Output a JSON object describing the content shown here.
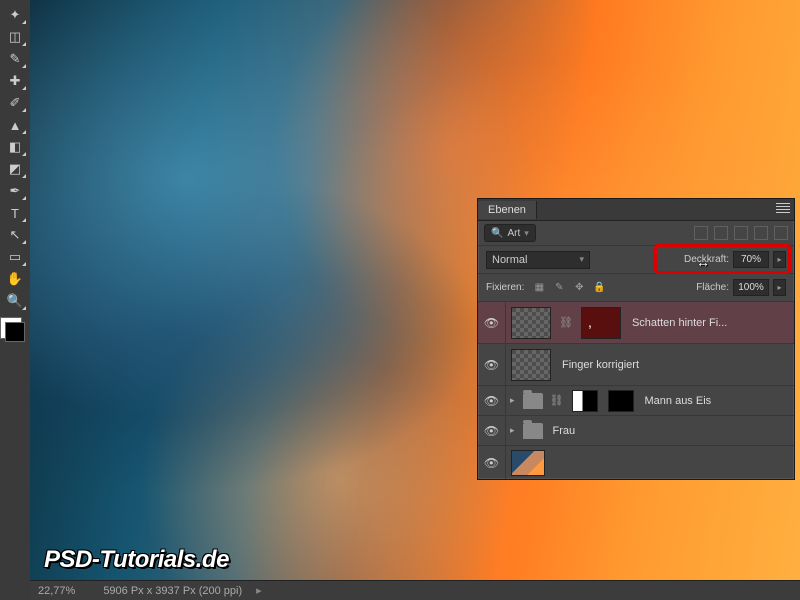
{
  "status": {
    "zoom": "22,77%",
    "dimensions": "5906 Px x 3937 Px (200 ppi)"
  },
  "watermark": "PSD-Tutorials.de",
  "panel": {
    "title": "Ebenen",
    "search_mode": "Art",
    "blend_mode": "Normal",
    "opacity_label": "Deckkraft:",
    "opacity_value": "70%",
    "fill_label": "Fläche:",
    "fill_value": "100%",
    "lock_label": "Fixieren:"
  },
  "layers": [
    {
      "name": "Schatten hinter Fi...",
      "selected": true,
      "type": "pixel-mask"
    },
    {
      "name": "Finger korrigiert",
      "selected": false,
      "type": "pixel"
    },
    {
      "name": "Mann aus Eis",
      "selected": false,
      "type": "group-mask"
    },
    {
      "name": "Frau",
      "selected": false,
      "type": "group"
    },
    {
      "name": "",
      "selected": false,
      "type": "photo"
    }
  ],
  "tools": [
    "move",
    "marquee",
    "lasso",
    "wand",
    "crop",
    "eyedropper",
    "heal",
    "brush",
    "stamp",
    "history",
    "eraser",
    "gradient",
    "blur",
    "dodge",
    "pen",
    "type",
    "path",
    "rect",
    "hand",
    "zoom"
  ]
}
